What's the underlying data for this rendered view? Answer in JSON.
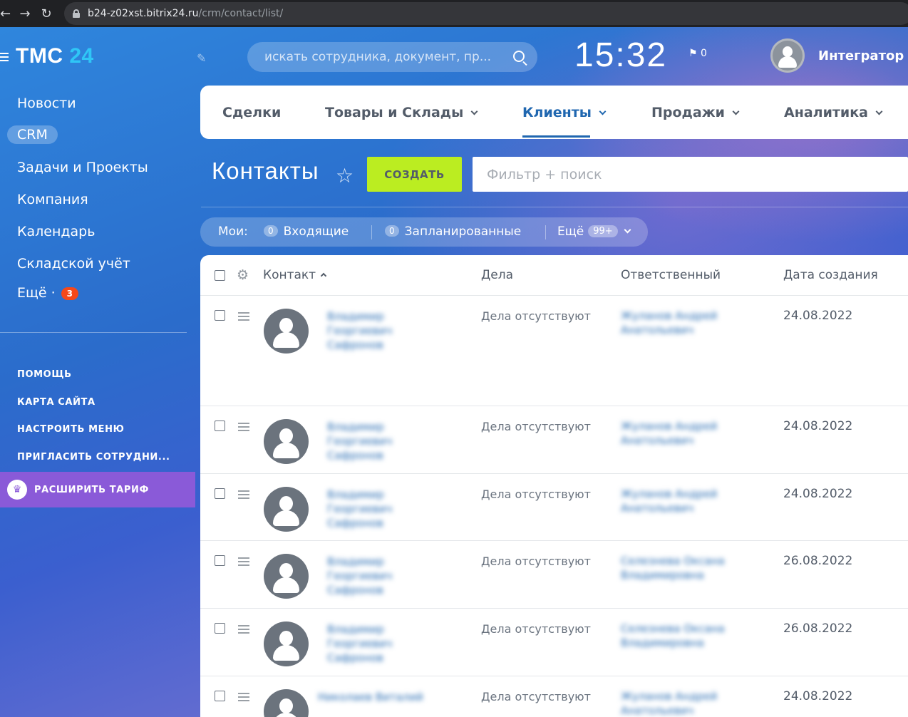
{
  "browser": {
    "url_domain": "b24-z02xst.bitrix24.ru",
    "url_path": "/crm/contact/list/"
  },
  "logo": {
    "part1": "ТМС",
    "part2": "24"
  },
  "sidebar": {
    "items": [
      {
        "label": "Новости"
      },
      {
        "label": "CRM"
      },
      {
        "label": "Задачи и Проекты"
      },
      {
        "label": "Компания"
      },
      {
        "label": "Календарь"
      },
      {
        "label": "Складской учёт"
      },
      {
        "label": "Ещё ·"
      }
    ],
    "more_badge": "3",
    "links": [
      "ПОМОЩЬ",
      "КАРТА САЙТА",
      "НАСТРОИТЬ МЕНЮ",
      "ПРИГЛАСИТЬ СОТРУДНИ..."
    ],
    "upgrade_label": "РАСШИРИТЬ ТАРИФ"
  },
  "header": {
    "search_placeholder": "искать сотрудника, документ, пр...",
    "clock": "15:32",
    "flag_count": "0",
    "user_name": "Интегратор I"
  },
  "tabs": [
    {
      "label": "Сделки"
    },
    {
      "label": "Товары и Склады"
    },
    {
      "label": "Клиенты"
    },
    {
      "label": "Продажи"
    },
    {
      "label": "Аналитика"
    }
  ],
  "page": {
    "title": "Контакты",
    "create_label": "СОЗДАТЬ",
    "filter_placeholder": "Фильтр + поиск"
  },
  "counters": {
    "mine": "Мои:",
    "incoming_count": "0",
    "incoming": "Входящие",
    "planned_count": "0",
    "planned": "Запланированные",
    "more": "Ещё",
    "more_count": "99+"
  },
  "grid": {
    "columns": [
      "Контакт",
      "Дела",
      "Ответственный",
      "Дата создания"
    ],
    "rows": [
      {
        "name1": "Владимир",
        "name2": "Георгиевич",
        "name3": "Сафронов",
        "activity": "Дела отсутствуют",
        "resp1": "Жуланов Андрей",
        "resp2": "Анатольевич",
        "date": "24.08.2022"
      },
      {
        "name1": "Владимир",
        "name2": "Георгиевич",
        "name3": "Сафронов",
        "activity": "Дела отсутствуют",
        "resp1": "Жуланов Андрей",
        "resp2": "Анатольевич",
        "date": "24.08.2022"
      },
      {
        "name1": "Владимир",
        "name2": "Георгиевич",
        "name3": "Сафронов",
        "activity": "Дела отсутствуют",
        "resp1": "Жуланов Андрей",
        "resp2": "Анатольевич",
        "date": "24.08.2022"
      },
      {
        "name1": "Владимир",
        "name2": "Георгиевич",
        "name3": "Сафронов",
        "activity": "Дела отсутствуют",
        "resp1": "Селезнева Оксана",
        "resp2": "Владимировна",
        "date": "26.08.2022"
      },
      {
        "name1": "Владимир",
        "name2": "Георгиевич",
        "name3": "Сафронов",
        "activity": "Дела отсутствуют",
        "resp1": "Селезнева Оксана",
        "resp2": "Владимировна",
        "date": "26.08.2022"
      },
      {
        "name1": "Николаев Виталий",
        "name2": "",
        "name3": "",
        "activity": "Дела отсутствуют",
        "resp1": "Жуланов Андрей",
        "resp2": "Анатольевич",
        "date": "24.08.2022"
      }
    ]
  },
  "colors": {
    "accent_create": "#bbed21",
    "active_tab": "#2067b0",
    "badge_red": "#f54819",
    "upgrade_bg": "#8a5ad8"
  }
}
